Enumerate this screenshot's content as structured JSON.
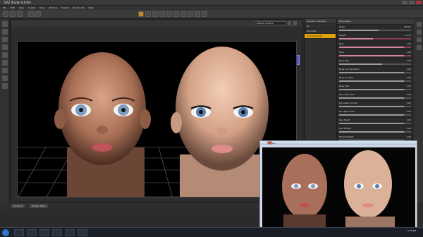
{
  "app": {
    "title": "DAZ Studio 4.6 Pro",
    "menu": [
      "File",
      "Edit",
      "View",
      "Create",
      "Tools",
      "Window",
      "Scripts",
      "Render Lib",
      "Help"
    ]
  },
  "viewport": {
    "camera_dropdown": "Default Camera",
    "tab_labels": [
      "Viewport",
      "Shader Mixer"
    ]
  },
  "scene_panel": {
    "dropdown": "Genesis 2 Female",
    "items": [
      {
        "label": "All",
        "selected": false
      },
      {
        "label": "Favorites",
        "selected": false
      },
      {
        "label": "Currently Used",
        "selected": true
      }
    ]
  },
  "properties": {
    "header": "Parameters",
    "rows": [
      {
        "label": "Scale",
        "value": "85.0%",
        "fill": 0.55,
        "pink": false
      },
      {
        "label": "Height",
        "value": "0.471",
        "fill": 0.47,
        "pink": true
      },
      {
        "label": "Ears",
        "value": "1.00",
        "fill": 0.9,
        "pink": true
      },
      {
        "label": "Tone",
        "value": "1.00",
        "fill": 0.9,
        "pink": true
      },
      {
        "label": "Eyes Size",
        "value": "1.00",
        "fill": 0.6,
        "pink": false
      },
      {
        "label": "Eyes Iris Correction",
        "value": "1.00",
        "fill": 0.9,
        "pink": false
      },
      {
        "label": "Eyes Iris Size",
        "value": "1.00",
        "fill": 0.9,
        "pink": false
      },
      {
        "label": "Eyes Size",
        "value": "1.00",
        "fill": 0.9,
        "pink": false
      },
      {
        "label": "Lip Lower Size",
        "value": "1.00",
        "fill": 0.9,
        "pink": false
      },
      {
        "label": "Lip Lower Curves",
        "value": "1.00",
        "fill": 0.9,
        "pink": false
      },
      {
        "label": "Lip Upper Size",
        "value": "1.00",
        "fill": 0.9,
        "pink": false
      },
      {
        "label": "Lips Heart",
        "value": "1.00",
        "fill": 0.9,
        "pink": false
      },
      {
        "label": "Lips Height",
        "value": "1.00",
        "fill": 0.9,
        "pink": false
      },
      {
        "label": "Mouth Height",
        "value": "1.00",
        "fill": 0.9,
        "pink": false
      },
      {
        "label": "Mouth Size",
        "value": "0.611",
        "fill": 0.61,
        "pink": false
      },
      {
        "label": "Mouth Width",
        "value": "1.00",
        "fill": 0.9,
        "pink": false
      }
    ]
  },
  "render_window": {
    "title": "Render 1"
  },
  "taskbar": {
    "time": "3:25 PM"
  },
  "colors": {
    "accent": "#e1a30c",
    "pink": "#d184a0",
    "viewport_bg": "#000000",
    "panel_bg": "#2a2a2a"
  }
}
